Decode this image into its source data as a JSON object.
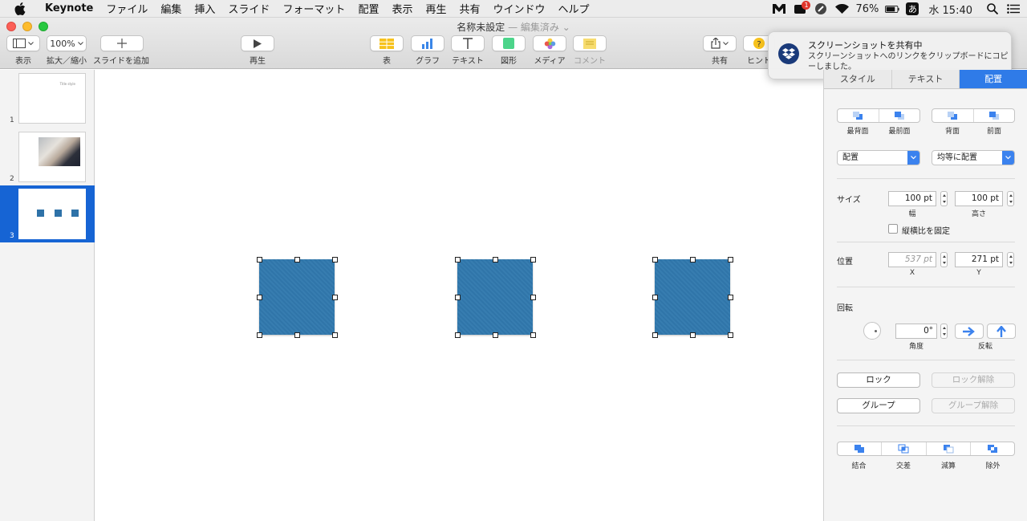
{
  "menubar": {
    "app_name": "Keynote",
    "items": [
      "ファイル",
      "編集",
      "挿入",
      "スライド",
      "フォーマット",
      "配置",
      "表示",
      "再生",
      "共有",
      "ウインドウ",
      "ヘルプ"
    ],
    "badge_count": "1",
    "battery": "76%",
    "input_method": "あ",
    "clock": "水 15:40"
  },
  "window": {
    "title": "名称未設定",
    "edited": "— 編集済み ⌄"
  },
  "toolbar": {
    "view_label": "表示",
    "zoom_value": "100%",
    "zoom_label": "拡大／縮小",
    "add_slide_label": "スライドを追加",
    "play_label": "再生",
    "table_label": "表",
    "chart_label": "グラフ",
    "text_label": "テキスト",
    "shape_label": "図形",
    "media_label": "メディア",
    "comment_label": "コメント",
    "share_label": "共有",
    "hint_label": "ヒント"
  },
  "notification": {
    "title": "スクリーンショットを共有中",
    "body": "スクリーンショットへのリンクをクリップボードにコピーしました。"
  },
  "navigator": {
    "slides": [
      {
        "number": "1",
        "text": "Title style"
      },
      {
        "number": "2"
      },
      {
        "number": "3"
      }
    ],
    "selected": "3"
  },
  "inspector": {
    "tabs": [
      "スタイル",
      "テキスト",
      "配置"
    ],
    "active_tab": "配置",
    "order": {
      "send_to_back": "最背面",
      "bring_to_front": "最前面",
      "backward": "背面",
      "forward": "前面"
    },
    "align_dropdown": "配置",
    "distribute_dropdown": "均等に配置",
    "size": {
      "label": "サイズ",
      "width": "100 pt",
      "width_label": "幅",
      "height": "100 pt",
      "height_label": "高さ",
      "constrain_label": "縦横比を固定"
    },
    "position": {
      "label": "位置",
      "x": "537 pt",
      "x_label": "X",
      "y": "271 pt",
      "y_label": "Y"
    },
    "rotate": {
      "label": "回転",
      "angle": "0°",
      "angle_label": "角度",
      "flip_label": "反転"
    },
    "lock_button": "ロック",
    "unlock_button": "ロック解除",
    "group_button": "グループ",
    "ungroup_button": "グループ解除",
    "combine": {
      "unite": "結合",
      "intersect": "交差",
      "subtract": "減算",
      "exclude": "除外"
    }
  },
  "colors": {
    "shape_fill": "#3179ae",
    "accent": "#2f7be8",
    "selection": "#1664d4"
  }
}
